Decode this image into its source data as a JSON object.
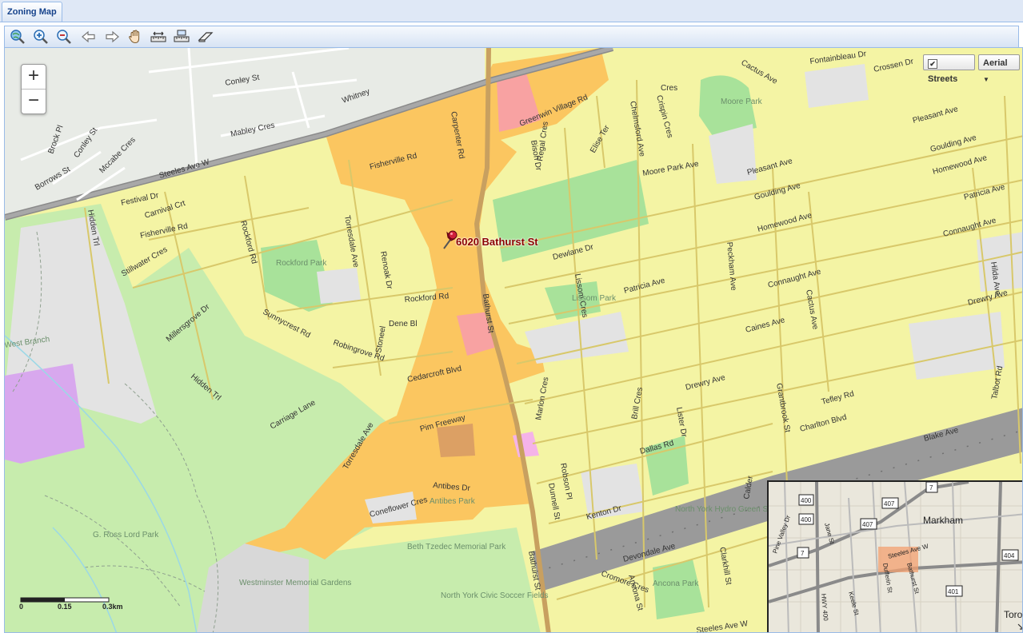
{
  "tab": {
    "title": "Zoning Map"
  },
  "toolbar": {
    "buttons": [
      {
        "name": "zoom-to-extent-button",
        "icon": "globe-magnifier-icon"
      },
      {
        "name": "zoom-in-button",
        "icon": "zoom-in-icon"
      },
      {
        "name": "zoom-out-button",
        "icon": "zoom-out-icon"
      },
      {
        "name": "previous-extent-button",
        "icon": "arrow-left-icon"
      },
      {
        "name": "next-extent-button",
        "icon": "arrow-right-icon"
      },
      {
        "name": "pan-button",
        "icon": "hand-icon"
      },
      {
        "name": "measure-distance-button",
        "icon": "ruler-icon"
      },
      {
        "name": "measure-area-button",
        "icon": "ruler-area-icon"
      },
      {
        "name": "clear-button",
        "icon": "eraser-icon"
      }
    ]
  },
  "map": {
    "zoom_in": "+",
    "zoom_out": "−",
    "layers": {
      "streets_label": "Streets",
      "streets_checked": "✔",
      "aerial_label": "Aerial"
    },
    "pin_label": "6020 Bathurst St",
    "scale": {
      "labels": [
        "0",
        "0.15",
        "0.3km"
      ]
    },
    "streets": [
      "Conley St",
      "Whitney",
      "Mabley Cres",
      "Brock Pl",
      "Conley St",
      "Mccabe Cres",
      "Borrows St",
      "Steeles Ave W",
      "Fontainbleau Dr",
      "Crossen Dr",
      "Cactus Ave",
      "Chelmsford Ave",
      "Cres",
      "Crispin Cres",
      "Greenwin Village Rd",
      "Bison Dr",
      "Regal Cres",
      "Elise Ter",
      "Moore Park Ave",
      "Pleasant Ave",
      "Pleasant Ave",
      "Goulding Ave",
      "Goulding Ave",
      "Homewood Ave",
      "Homewood Ave",
      "Patricia Ave",
      "Patricia Ave",
      "Connaught Ave",
      "Connaught Ave",
      "Hilda Ave",
      "Drewry Ave",
      "Drewry Ave",
      "Fisherville Rd",
      "Fisherville Rd",
      "Carpenter Rd",
      "Festival Dr",
      "Carnival Crt",
      "Hidden Trl",
      "Stillwater Cres",
      "Rockford Rd",
      "Rockford Rd",
      "Torresdale Ave",
      "Renoak Dr",
      "Dewlane Dr",
      "Lissom Cres",
      "Peckham Ave",
      "Cactus Ave",
      "Caines Ave",
      "Bathurst St",
      "Millersgrove Dr",
      "Sunnycrest Rd",
      "Robingrove Rd",
      "Stoneel",
      "Dene Bl",
      "Cedarcroft Blvd",
      "Hidden Trl",
      "Carriage Lane",
      "Torresdale Ave",
      "Pim Freeway",
      "Marlon Cres",
      "Brill Cres",
      "Lister Dr",
      "Grantbrook St",
      "Tefley Rd",
      "Charlton Blvd",
      "Talbot Rd",
      "Blake Ave",
      "Dallas Rd",
      "Robson Pl",
      "Antibes Dr",
      "Coneflower Cres",
      "Dunnell St",
      "Kenton Dr",
      "Devondale Ave",
      "Clarkhill St",
      "Calder",
      "Cromore Cres",
      "Ancona St",
      "Bathurst St",
      "Steeles Ave W"
    ],
    "parks": [
      "Moore Park",
      "Rockford Park",
      "Lissom Park",
      "Antibes Park",
      "North York Hydro Green Space",
      "G. Ross Lord Park",
      "Beth Tzedec Memorial Park",
      "Westminster Memorial Gardens",
      "North York Civic Soccer Fields",
      "Ancona Park",
      "West Branch"
    ],
    "overview": {
      "labels": [
        "Markham",
        "Toronto",
        "Steeles Ave W",
        "Dufferin St",
        "Bathurst St",
        "Keele St",
        "Jane St",
        "Pine Valley Dr",
        "HWY 400"
      ],
      "shields": [
        "400",
        "400",
        "407",
        "407",
        "7",
        "7",
        "404",
        "401"
      ]
    }
  }
}
